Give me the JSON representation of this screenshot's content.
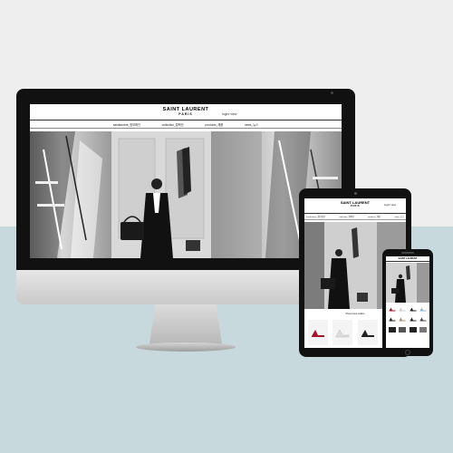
{
  "brand": {
    "name": "SAINT LAURENT",
    "city": "PARIS"
  },
  "header": {
    "login_link": "login/ view"
  },
  "nav": {
    "items": [
      {
        "label": "saintlaurent_정보확인"
      },
      {
        "label": "collection_컬렉션"
      },
      {
        "label": "products_제품"
      },
      {
        "label": "news_뉴스"
      }
    ]
  },
  "tablet": {
    "section_title": "Shoes best sellers"
  },
  "colors": {
    "background_top": "#eeeeee",
    "background_bottom": "#c7d9dc",
    "device_frame": "#111111",
    "device_silver": "#d0d0d0"
  }
}
